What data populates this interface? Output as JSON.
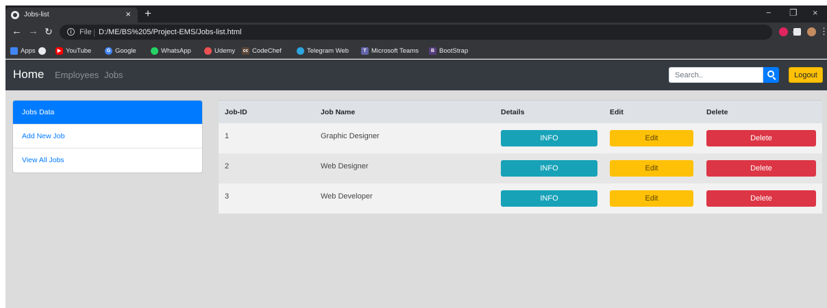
{
  "browser": {
    "tab_title": "Jobs-list",
    "tab_close": "×",
    "new_tab": "+",
    "window_controls": {
      "minimize": "−",
      "maximize": "❐",
      "close": "×"
    },
    "url_label": "File",
    "url_separator": "|",
    "url": "D:/ME/BS%205/Project-EMS/Jobs-list.html",
    "bookmarks": [
      {
        "label": "Apps",
        "icon": "apps-grid-icon",
        "color": "#4285f4"
      },
      {
        "label": "",
        "icon": "chrome-icon",
        "color": "#e8eaed"
      },
      {
        "label": "YouTube",
        "icon": "youtube-icon",
        "color": "#ff0000"
      },
      {
        "label": "Google",
        "icon": "google-icon",
        "color": "#4285f4"
      },
      {
        "label": "WhatsApp",
        "icon": "whatsapp-icon",
        "color": "#25d366"
      },
      {
        "label": "Udemy",
        "icon": "udemy-icon",
        "color": "#ec5252"
      },
      {
        "label": "CodeChef",
        "icon": "codechef-icon",
        "color": "#5b4638"
      },
      {
        "label": "Telegram Web",
        "icon": "telegram-icon",
        "color": "#2ca5e0"
      },
      {
        "label": "Microsoft Teams",
        "icon": "teams-icon",
        "color": "#6264a7"
      },
      {
        "label": "BootStrap",
        "icon": "bootstrap-icon",
        "color": "#563d7c"
      }
    ]
  },
  "navbar": {
    "brand": "Home",
    "links": [
      "Employees",
      "Jobs"
    ],
    "search_placeholder": "Search..",
    "logout": "Logout"
  },
  "sidebar": {
    "items": [
      {
        "label": "Jobs Data",
        "active": true
      },
      {
        "label": "Add New Job",
        "active": false
      },
      {
        "label": "View All Jobs",
        "active": false
      }
    ]
  },
  "table": {
    "headers": [
      "Job-ID",
      "Job Name",
      "Details",
      "Edit",
      "Delete"
    ],
    "rows": [
      {
        "id": "1",
        "name": "Graphic Designer",
        "info": "INFO",
        "edit": "Edit",
        "delete": "Delete"
      },
      {
        "id": "2",
        "name": "Web Designer",
        "info": "INFO",
        "edit": "Edit",
        "delete": "Delete"
      },
      {
        "id": "3",
        "name": "Web Developer",
        "info": "INFO",
        "edit": "Edit",
        "delete": "Delete"
      }
    ]
  },
  "colors": {
    "primary": "#007bff",
    "info": "#17a2b8",
    "warning": "#ffc107",
    "danger": "#dc3545",
    "navbar": "#343a40"
  }
}
